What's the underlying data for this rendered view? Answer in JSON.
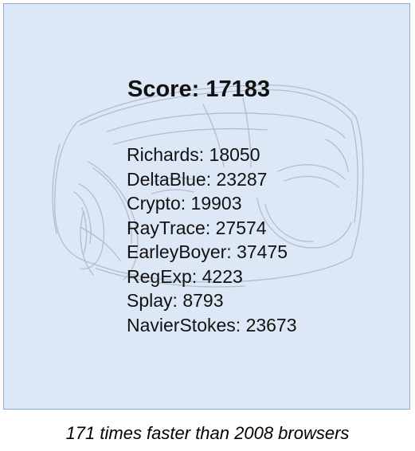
{
  "score": {
    "label": "Score:",
    "value": "17183"
  },
  "results": [
    {
      "name": "Richards",
      "value": "18050"
    },
    {
      "name": "DeltaBlue",
      "value": "23287"
    },
    {
      "name": "Crypto",
      "value": "19903"
    },
    {
      "name": "RayTrace",
      "value": "27574"
    },
    {
      "name": "EarleyBoyer",
      "value": "37475"
    },
    {
      "name": "RegExp",
      "value": "4223"
    },
    {
      "name": "Splay",
      "value": "8793"
    },
    {
      "name": "NavierStokes",
      "value": "23673"
    }
  ],
  "caption": "171 times faster than 2008 browsers",
  "colors": {
    "panel_background": "#dde8f7",
    "panel_border": "#8eaadb",
    "text": "#111111"
  },
  "icons": {
    "background_sketch": "car-sketch-watermark"
  }
}
